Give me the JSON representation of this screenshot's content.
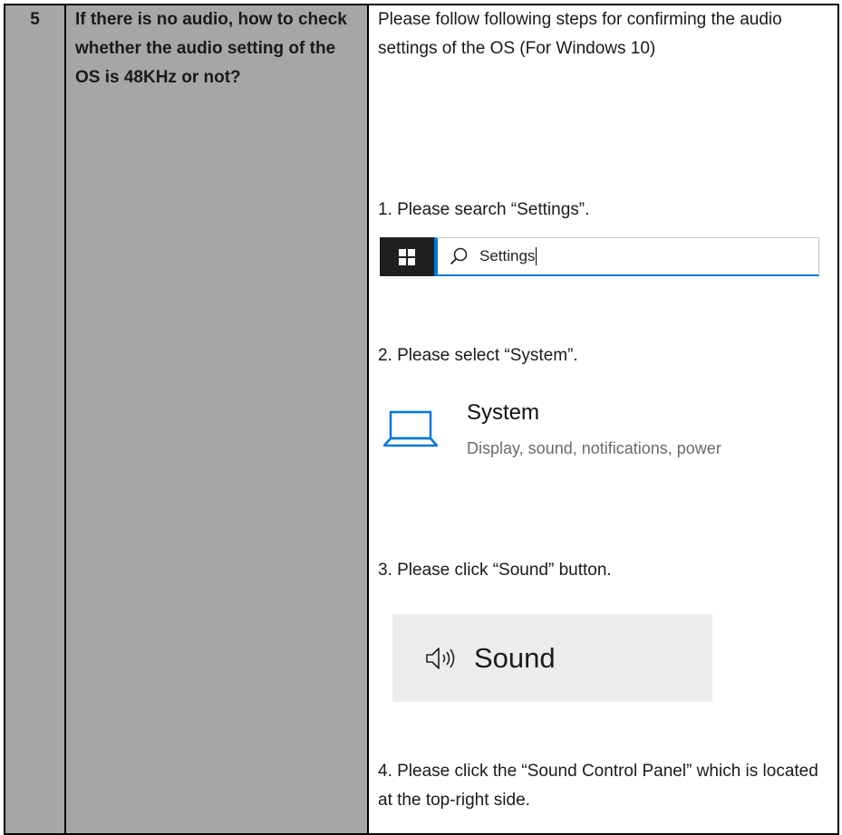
{
  "row": {
    "number": "5",
    "question": "If there is no audio, how to check whether the audio setting of the OS is 48KHz or not?",
    "intro": "Please follow following steps for confirming the audio settings of the OS (For Windows 10)",
    "step1": "1. Please search “Settings”.",
    "search": {
      "value": "Settings",
      "icon": "search-icon",
      "accent": "#0078d4"
    },
    "step2": "2. Please select “System”.",
    "system": {
      "title": "System",
      "description": "Display, sound, notifications, power",
      "icon": "laptop-icon",
      "icon_color": "#0078d4"
    },
    "step3": "3. Please click “Sound” button.",
    "sound": {
      "label": "Sound",
      "icon": "speaker-icon"
    },
    "step4": "4. Please click the “Sound Control Panel” which is located at the top-right side."
  }
}
